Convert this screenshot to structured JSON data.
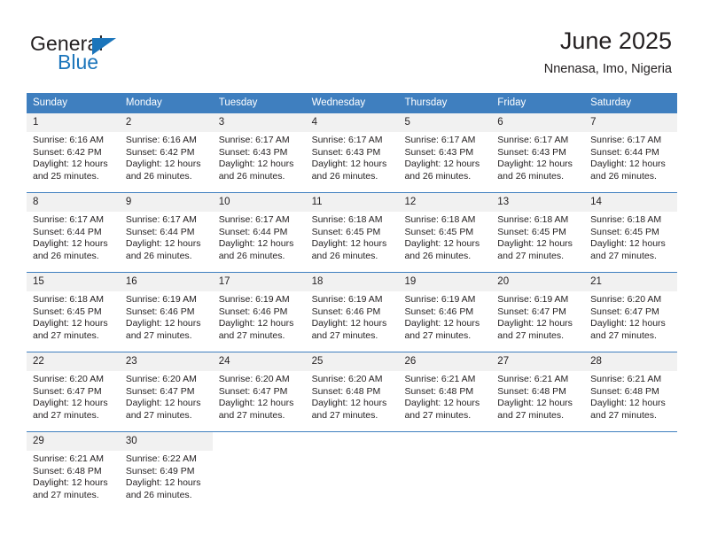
{
  "branding": {
    "name_top": "General",
    "name_bottom": "Blue",
    "accent_color": "#1b75bb"
  },
  "header": {
    "title": "June 2025",
    "subtitle": "Nnenasa, Imo, Nigeria"
  },
  "calendar": {
    "header_bg": "#3f7fbf",
    "daynum_bg": "#f1f1f1",
    "weekdays": [
      "Sunday",
      "Monday",
      "Tuesday",
      "Wednesday",
      "Thursday",
      "Friday",
      "Saturday"
    ],
    "labels": {
      "sunrise": "Sunrise:",
      "sunset": "Sunset:",
      "daylight": "Daylight:"
    },
    "weeks": [
      [
        {
          "day": "1",
          "sunrise": "Sunrise: 6:16 AM",
          "sunset": "Sunset: 6:42 PM",
          "daylight": "Daylight: 12 hours and 25 minutes."
        },
        {
          "day": "2",
          "sunrise": "Sunrise: 6:16 AM",
          "sunset": "Sunset: 6:42 PM",
          "daylight": "Daylight: 12 hours and 26 minutes."
        },
        {
          "day": "3",
          "sunrise": "Sunrise: 6:17 AM",
          "sunset": "Sunset: 6:43 PM",
          "daylight": "Daylight: 12 hours and 26 minutes."
        },
        {
          "day": "4",
          "sunrise": "Sunrise: 6:17 AM",
          "sunset": "Sunset: 6:43 PM",
          "daylight": "Daylight: 12 hours and 26 minutes."
        },
        {
          "day": "5",
          "sunrise": "Sunrise: 6:17 AM",
          "sunset": "Sunset: 6:43 PM",
          "daylight": "Daylight: 12 hours and 26 minutes."
        },
        {
          "day": "6",
          "sunrise": "Sunrise: 6:17 AM",
          "sunset": "Sunset: 6:43 PM",
          "daylight": "Daylight: 12 hours and 26 minutes."
        },
        {
          "day": "7",
          "sunrise": "Sunrise: 6:17 AM",
          "sunset": "Sunset: 6:44 PM",
          "daylight": "Daylight: 12 hours and 26 minutes."
        }
      ],
      [
        {
          "day": "8",
          "sunrise": "Sunrise: 6:17 AM",
          "sunset": "Sunset: 6:44 PM",
          "daylight": "Daylight: 12 hours and 26 minutes."
        },
        {
          "day": "9",
          "sunrise": "Sunrise: 6:17 AM",
          "sunset": "Sunset: 6:44 PM",
          "daylight": "Daylight: 12 hours and 26 minutes."
        },
        {
          "day": "10",
          "sunrise": "Sunrise: 6:17 AM",
          "sunset": "Sunset: 6:44 PM",
          "daylight": "Daylight: 12 hours and 26 minutes."
        },
        {
          "day": "11",
          "sunrise": "Sunrise: 6:18 AM",
          "sunset": "Sunset: 6:45 PM",
          "daylight": "Daylight: 12 hours and 26 minutes."
        },
        {
          "day": "12",
          "sunrise": "Sunrise: 6:18 AM",
          "sunset": "Sunset: 6:45 PM",
          "daylight": "Daylight: 12 hours and 26 minutes."
        },
        {
          "day": "13",
          "sunrise": "Sunrise: 6:18 AM",
          "sunset": "Sunset: 6:45 PM",
          "daylight": "Daylight: 12 hours and 27 minutes."
        },
        {
          "day": "14",
          "sunrise": "Sunrise: 6:18 AM",
          "sunset": "Sunset: 6:45 PM",
          "daylight": "Daylight: 12 hours and 27 minutes."
        }
      ],
      [
        {
          "day": "15",
          "sunrise": "Sunrise: 6:18 AM",
          "sunset": "Sunset: 6:45 PM",
          "daylight": "Daylight: 12 hours and 27 minutes."
        },
        {
          "day": "16",
          "sunrise": "Sunrise: 6:19 AM",
          "sunset": "Sunset: 6:46 PM",
          "daylight": "Daylight: 12 hours and 27 minutes."
        },
        {
          "day": "17",
          "sunrise": "Sunrise: 6:19 AM",
          "sunset": "Sunset: 6:46 PM",
          "daylight": "Daylight: 12 hours and 27 minutes."
        },
        {
          "day": "18",
          "sunrise": "Sunrise: 6:19 AM",
          "sunset": "Sunset: 6:46 PM",
          "daylight": "Daylight: 12 hours and 27 minutes."
        },
        {
          "day": "19",
          "sunrise": "Sunrise: 6:19 AM",
          "sunset": "Sunset: 6:46 PM",
          "daylight": "Daylight: 12 hours and 27 minutes."
        },
        {
          "day": "20",
          "sunrise": "Sunrise: 6:19 AM",
          "sunset": "Sunset: 6:47 PM",
          "daylight": "Daylight: 12 hours and 27 minutes."
        },
        {
          "day": "21",
          "sunrise": "Sunrise: 6:20 AM",
          "sunset": "Sunset: 6:47 PM",
          "daylight": "Daylight: 12 hours and 27 minutes."
        }
      ],
      [
        {
          "day": "22",
          "sunrise": "Sunrise: 6:20 AM",
          "sunset": "Sunset: 6:47 PM",
          "daylight": "Daylight: 12 hours and 27 minutes."
        },
        {
          "day": "23",
          "sunrise": "Sunrise: 6:20 AM",
          "sunset": "Sunset: 6:47 PM",
          "daylight": "Daylight: 12 hours and 27 minutes."
        },
        {
          "day": "24",
          "sunrise": "Sunrise: 6:20 AM",
          "sunset": "Sunset: 6:47 PM",
          "daylight": "Daylight: 12 hours and 27 minutes."
        },
        {
          "day": "25",
          "sunrise": "Sunrise: 6:20 AM",
          "sunset": "Sunset: 6:48 PM",
          "daylight": "Daylight: 12 hours and 27 minutes."
        },
        {
          "day": "26",
          "sunrise": "Sunrise: 6:21 AM",
          "sunset": "Sunset: 6:48 PM",
          "daylight": "Daylight: 12 hours and 27 minutes."
        },
        {
          "day": "27",
          "sunrise": "Sunrise: 6:21 AM",
          "sunset": "Sunset: 6:48 PM",
          "daylight": "Daylight: 12 hours and 27 minutes."
        },
        {
          "day": "28",
          "sunrise": "Sunrise: 6:21 AM",
          "sunset": "Sunset: 6:48 PM",
          "daylight": "Daylight: 12 hours and 27 minutes."
        }
      ],
      [
        {
          "day": "29",
          "sunrise": "Sunrise: 6:21 AM",
          "sunset": "Sunset: 6:48 PM",
          "daylight": "Daylight: 12 hours and 27 minutes."
        },
        {
          "day": "30",
          "sunrise": "Sunrise: 6:22 AM",
          "sunset": "Sunset: 6:49 PM",
          "daylight": "Daylight: 12 hours and 26 minutes."
        },
        {
          "day": "",
          "sunrise": "",
          "sunset": "",
          "daylight": ""
        },
        {
          "day": "",
          "sunrise": "",
          "sunset": "",
          "daylight": ""
        },
        {
          "day": "",
          "sunrise": "",
          "sunset": "",
          "daylight": ""
        },
        {
          "day": "",
          "sunrise": "",
          "sunset": "",
          "daylight": ""
        },
        {
          "day": "",
          "sunrise": "",
          "sunset": "",
          "daylight": ""
        }
      ]
    ]
  }
}
